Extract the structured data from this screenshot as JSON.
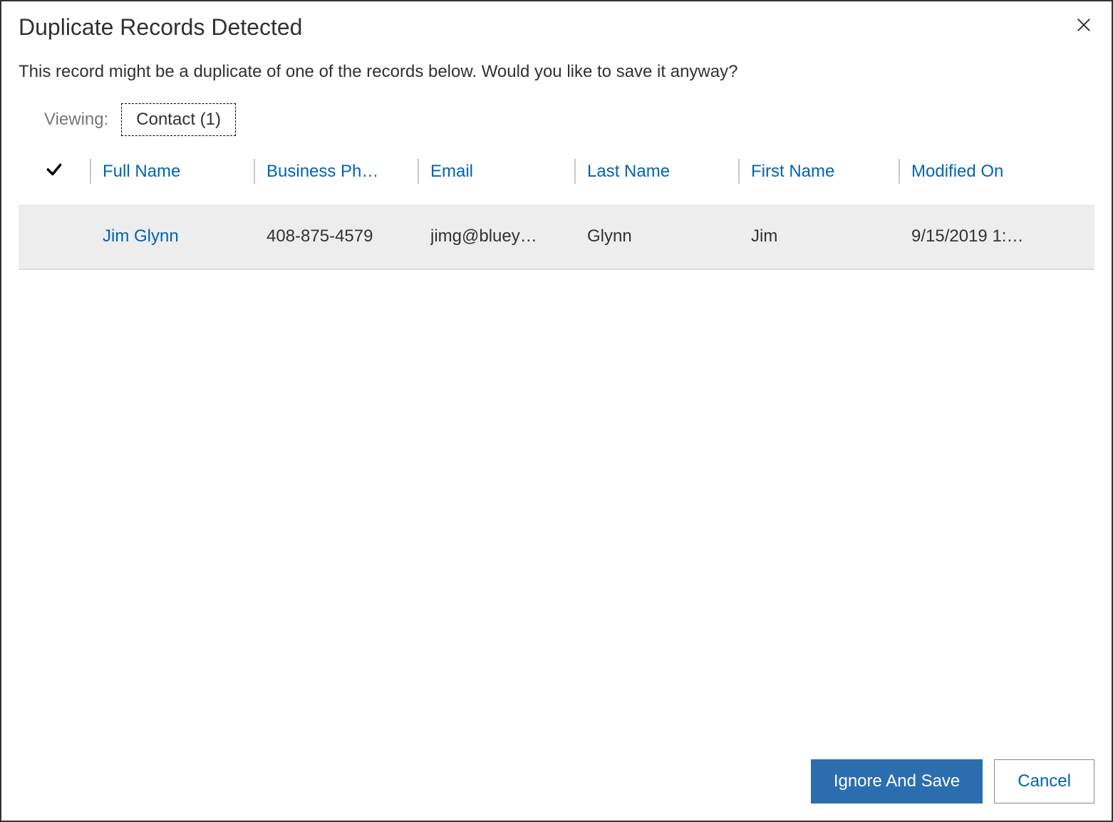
{
  "dialog": {
    "title": "Duplicate Records Detected",
    "message": "This record might be a duplicate of one of the records below. Would you like to save it anyway?"
  },
  "viewing": {
    "label": "Viewing:",
    "tab": "Contact (1)"
  },
  "grid": {
    "columns": {
      "fullname": "Full Name",
      "phone": "Business Ph…",
      "email": "Email",
      "lastname": "Last Name",
      "firstname": "First Name",
      "modified": "Modified On"
    },
    "rows": [
      {
        "fullname": "Jim Glynn",
        "phone": "408-875-4579",
        "email": "jimg@bluey…",
        "lastname": "Glynn",
        "firstname": "Jim",
        "modified": "9/15/2019 1:…"
      }
    ]
  },
  "footer": {
    "primary": "Ignore And Save",
    "secondary": "Cancel"
  }
}
